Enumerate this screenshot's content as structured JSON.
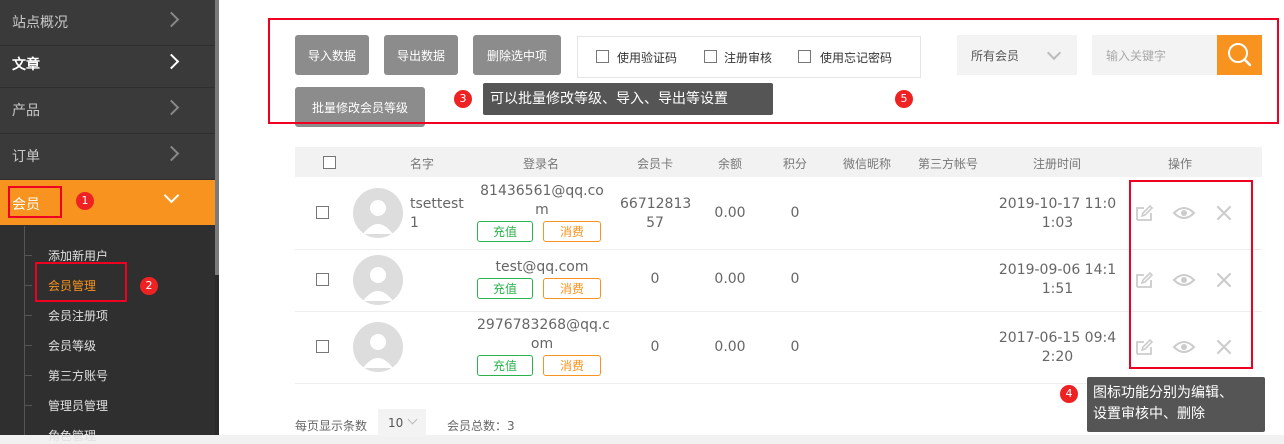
{
  "sidebar": {
    "items": [
      {
        "label": "站点概况"
      },
      {
        "label": "文章"
      },
      {
        "label": "产品"
      },
      {
        "label": "订单"
      },
      {
        "label": "会员"
      }
    ],
    "sub_items": [
      {
        "label": "添加新用户"
      },
      {
        "label": "会员管理"
      },
      {
        "label": "会员注册项"
      },
      {
        "label": "会员等级"
      },
      {
        "label": "第三方账号"
      },
      {
        "label": "管理员管理"
      },
      {
        "label": "角色管理"
      }
    ]
  },
  "toolbar": {
    "import_label": "导入数据",
    "export_label": "导出数据",
    "delete_label": "删除选中项",
    "batch_label": "批量修改会员等级",
    "checkboxes": [
      {
        "label": "使用验证码"
      },
      {
        "label": "注册审核"
      },
      {
        "label": "使用忘记密码"
      }
    ],
    "member_select": "所有会员",
    "search_placeholder": "输入关键字"
  },
  "annotations": {
    "n1": "1",
    "n2": "2",
    "n3": "3",
    "n4": "4",
    "n5": "5",
    "tip3": "可以批量修改等级、导入、导出等设置",
    "tip4_line1": "图标功能分别为编辑、",
    "tip4_line2": "设置审核中、删除"
  },
  "table": {
    "headers": [
      "名字",
      "登录名",
      "会员卡",
      "余额",
      "积分",
      "微信昵称",
      "第三方帐号",
      "注册时间",
      "操作"
    ],
    "recharge_label": "充值",
    "consume_label": "消费",
    "rows": [
      {
        "name_l1": "tsettest",
        "name_l2": "1",
        "login_l1": "81436561@qq.co",
        "login_l2": "m",
        "card_l1": "66712813",
        "card_l2": "57",
        "balance": "0.00",
        "points": "0",
        "date_l1": "2019-10-17 11:0",
        "date_l2": "1:03"
      },
      {
        "name_l1": "",
        "name_l2": "",
        "login_l1": "test@qq.com",
        "login_l2": "",
        "card_l1": "0",
        "card_l2": "",
        "balance": "0.00",
        "points": "0",
        "date_l1": "2019-09-06 14:1",
        "date_l2": "1:51"
      },
      {
        "name_l1": "",
        "name_l2": "",
        "login_l1": "2976783268@qq.c",
        "login_l2": "om",
        "card_l1": "0",
        "card_l2": "",
        "balance": "0.00",
        "points": "0",
        "date_l1": "2017-06-15 09:4",
        "date_l2": "2:20"
      }
    ]
  },
  "footer": {
    "per_page_label": "每页显示条数",
    "per_page_value": "10",
    "total_label": "会员总数：3"
  },
  "colors": {
    "accent": "#f7931e",
    "annotation_red": "#e02020",
    "green": "#2bb24c"
  }
}
